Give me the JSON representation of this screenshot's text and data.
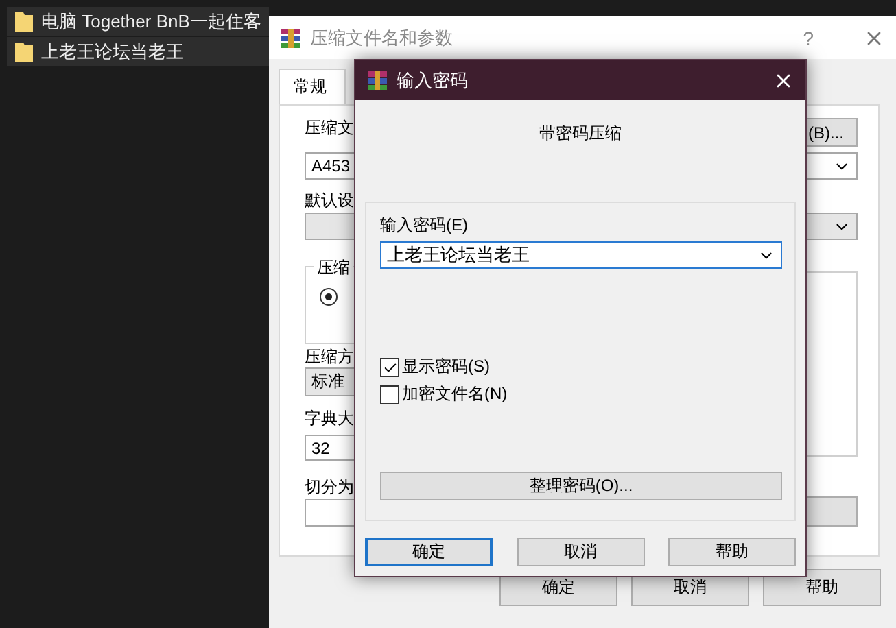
{
  "explorer": {
    "items": [
      {
        "name": "电脑 Together BnB一起住客"
      },
      {
        "name": "上老王论坛当老王"
      }
    ]
  },
  "back_dialog": {
    "title": "压缩文件名和参数",
    "help": "?",
    "tabs": [
      {
        "label": "常规",
        "selected": true
      }
    ],
    "archive_label": "压缩文",
    "archive_value": "A453",
    "browse_button": "(B)...",
    "profile_label": "默认设",
    "group_label": "压缩",
    "format_radio": {
      "selected": true
    },
    "method_label": "压缩方",
    "method_value": "标准",
    "dict_label": "字典大",
    "dict_value": "32",
    "split_label": "切分为",
    "buttons": [
      "确定",
      "取消",
      "帮助"
    ]
  },
  "front_dialog": {
    "title": "输入密码",
    "heading": "带密码压缩",
    "password_label": "输入密码(E)",
    "password_value": "上老王论坛当老王",
    "options": [
      {
        "label": "显示密码(S)",
        "checked": true
      },
      {
        "label": "加密文件名(N)",
        "checked": false
      }
    ],
    "organize_button": "整理密码(O)...",
    "buttons": [
      {
        "label": "确定",
        "default": true
      },
      {
        "label": "取消",
        "default": false
      },
      {
        "label": "帮助",
        "default": false
      }
    ]
  }
}
